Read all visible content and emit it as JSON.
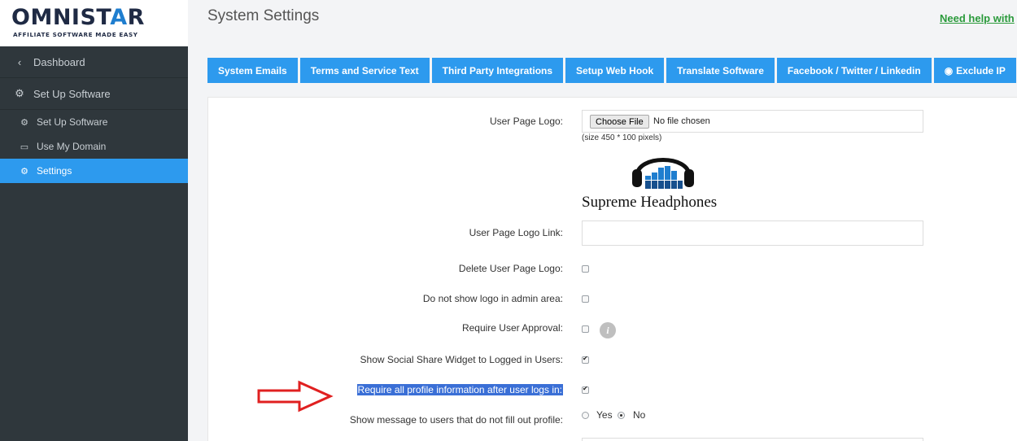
{
  "brand": {
    "logo_text_a": "OMNIST",
    "logo_text_star": "A",
    "logo_text_b": "R",
    "tagline": "AFFILIATE SOFTWARE MADE EASY"
  },
  "sidebar": {
    "dashboard": "Dashboard",
    "setup": "Set Up Software",
    "items": [
      {
        "label": "Set Up Software",
        "icon": "cogs-icon"
      },
      {
        "label": "Use My Domain",
        "icon": "monitor-icon"
      },
      {
        "label": "Settings",
        "icon": "gear-icon",
        "active": true
      }
    ]
  },
  "header": {
    "title": "System Settings",
    "help": "Need help with"
  },
  "tabs": [
    "System Emails",
    "Terms and Service Text",
    "Third Party Integrations",
    "Setup Web Hook",
    "Translate Software",
    "Facebook / Twitter / Linkedin",
    "Exclude IP"
  ],
  "form": {
    "user_page_logo": {
      "label": "User Page Logo:",
      "button": "Choose File",
      "file_status": "No file chosen",
      "note": "(size 450 * 100 pixels)",
      "preview_name": "Supreme Headphones"
    },
    "logo_link": {
      "label": "User Page Logo Link:",
      "value": ""
    },
    "delete_logo": {
      "label": "Delete User Page Logo:",
      "checked": false
    },
    "no_logo_admin": {
      "label": "Do not show logo in admin area:",
      "checked": false
    },
    "require_approval": {
      "label": "Require User Approval:",
      "checked": false
    },
    "social_share": {
      "label": "Show Social Share Widget to Logged in Users:",
      "checked": true
    },
    "require_profile": {
      "label": "Require all profile information after user logs in:",
      "checked": true
    },
    "show_message": {
      "label": "Show message to users that do not fill out profile:",
      "yes": "Yes",
      "no": "No",
      "selected": "No"
    }
  },
  "colors": {
    "accent": "#2d9aee",
    "sidebar": "#2f373c",
    "help_link": "#2a9a3b",
    "arrow": "#e02020"
  }
}
